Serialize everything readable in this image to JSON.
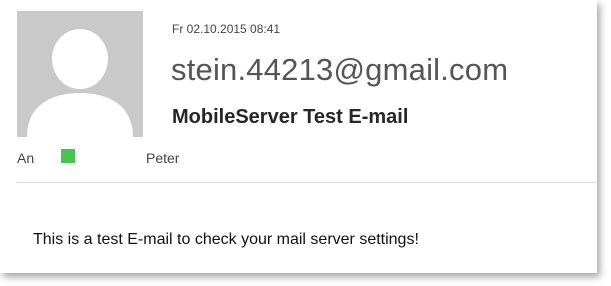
{
  "email": {
    "timestamp": "Fr 02.10.2015 08:41",
    "sender": "stein.44213@gmail.com",
    "subject": "MobileServer Test E-mail",
    "to_label": "An",
    "recipient": "Peter",
    "presence_color": "#4ac451",
    "body": "This is a test E-mail to check your mail server settings!"
  },
  "avatar": {
    "icon": "default-person-icon",
    "background_color": "#c9c9c9",
    "silhouette_color": "#ffffff"
  }
}
